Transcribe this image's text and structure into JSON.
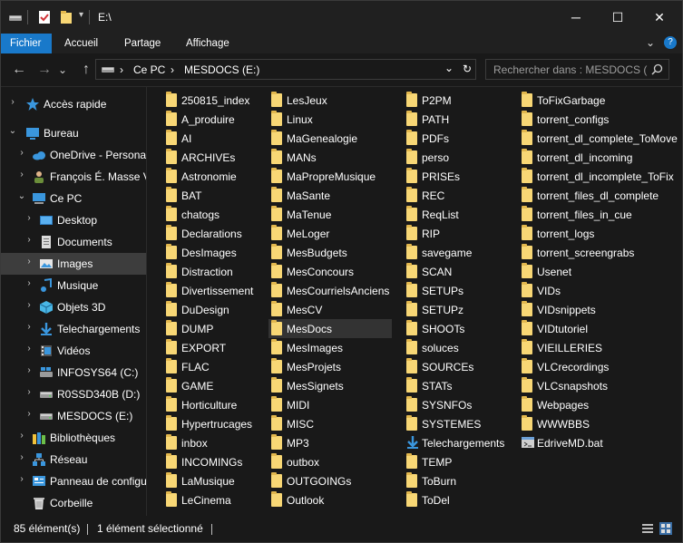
{
  "window": {
    "title": "E:\\",
    "controls": {
      "minimize": "─",
      "maximize": "☐",
      "close": "✕"
    }
  },
  "ribbon": {
    "tabs": [
      "Fichier",
      "Accueil",
      "Partage",
      "Affichage"
    ],
    "active_tab_color": "#1979ca"
  },
  "address": {
    "back": "←",
    "forward": "→",
    "recent": "⌄",
    "up": "↑",
    "crumbs": [
      "Ce PC",
      "MESDOCS (E:)"
    ],
    "separator": "›",
    "dropdown": "⌄",
    "refresh": "↻"
  },
  "search": {
    "placeholder": "Rechercher dans : MESDOCS (E:)",
    "icon": "search-icon"
  },
  "nav": {
    "items": [
      {
        "label": "Accès rapide",
        "icon": "star-icon"
      },
      {
        "label": "Bureau",
        "icon": "desktop-blue-icon"
      },
      {
        "label": "OneDrive - Personal",
        "icon": "cloud-icon"
      },
      {
        "label": "François É. Masse V.",
        "icon": "user-icon"
      },
      {
        "label": "Ce PC",
        "icon": "computer-icon"
      },
      {
        "label": "Desktop",
        "icon": "desktop-icon"
      },
      {
        "label": "Documents",
        "icon": "documents-icon"
      },
      {
        "label": "Images",
        "icon": "images-icon"
      },
      {
        "label": "Musique",
        "icon": "music-icon"
      },
      {
        "label": "Objets 3D",
        "icon": "cube-icon"
      },
      {
        "label": "Telechargements",
        "icon": "download-icon"
      },
      {
        "label": "Vidéos",
        "icon": "video-icon"
      },
      {
        "label": "INFOSYS64 (C:)",
        "icon": "drive-windows-icon"
      },
      {
        "label": "R0SSD340B (D:)",
        "icon": "drive-icon"
      },
      {
        "label": "MESDOCS (E:)",
        "icon": "drive-icon"
      },
      {
        "label": "Bibliothèques",
        "icon": "library-icon"
      },
      {
        "label": "Réseau",
        "icon": "network-icon"
      },
      {
        "label": "Panneau de configuration",
        "icon": "control-panel-icon"
      },
      {
        "label": "Corbeille",
        "icon": "recycle-bin-icon"
      }
    ],
    "selected": "Images"
  },
  "files": {
    "columns": [
      [
        "250815_index",
        "A_produire",
        "AI",
        "ARCHIVEs",
        "Astronomie",
        "BAT",
        "chatogs",
        "Declarations",
        "DesImages",
        "Distraction",
        "Divertissement",
        "DuDesign",
        "DUMP",
        "EXPORT",
        "FLAC",
        "GAME",
        "Horticulture",
        "Hypertrucages",
        "inbox",
        "INCOMINGs",
        "LaMusique",
        "LeCinema"
      ],
      [
        "LesJeux",
        "Linux",
        "MaGenealogie",
        "MANs",
        "MaPropreMusique",
        "MaSante",
        "MaTenue",
        "MeLoger",
        "MesBudgets",
        "MesConcours",
        "MesCourrielsAnciens",
        "MesCV",
        "MesDocs",
        "MesImages",
        "MesProjets",
        "MesSignets",
        "MIDI",
        "MISC",
        "MP3",
        "outbox",
        "OUTGOINGs",
        "Outlook"
      ],
      [
        "P2PM",
        "PATH",
        "PDFs",
        "perso",
        "PRISEs",
        "REC",
        "ReqList",
        "RIP",
        "savegame",
        "SCAN",
        "SETUPs",
        "SETUPz",
        "SHOOTs",
        "soluces",
        "SOURCEs",
        "STATs",
        "SYSNFOs",
        "SYSTEMES",
        "Telechargements",
        "TEMP",
        "ToBurn",
        "ToDel"
      ],
      [
        "ToFixGarbage",
        "torrent_configs",
        "torrent_dl_complete_ToMove",
        "torrent_dl_incoming",
        "torrent_dl_incomplete_ToFix",
        "torrent_files_dl_complete",
        "torrent_files_in_cue",
        "torrent_logs",
        "torrent_screengrabs",
        "Usenet",
        "VIDs",
        "VIDsnippets",
        "VIDtutoriel",
        "VIEILLERIES",
        "VLCrecordings",
        "VLCsnapshots",
        "Webpages",
        "WWWBBS",
        "EdriveMD.bat"
      ]
    ],
    "selected": "MesDocs",
    "special": {
      "Telechargements": "download-icon",
      "EdriveMD.bat": "bat-file-icon"
    },
    "folder_color": "#f8d775"
  },
  "status": {
    "count": "85 élément(s)",
    "selection": "1 élément sélectionné"
  }
}
